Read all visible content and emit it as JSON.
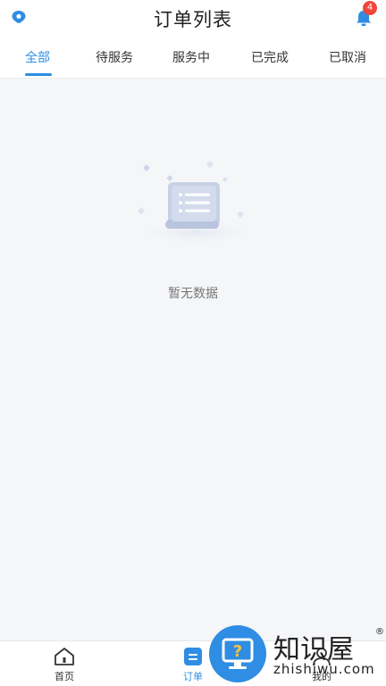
{
  "header": {
    "title": "订单列表",
    "notification_count": "4",
    "left_icon": "location-pin-icon",
    "bell_icon": "bell-icon"
  },
  "tabs": [
    {
      "label": "全部",
      "active": true
    },
    {
      "label": "待服务",
      "active": false
    },
    {
      "label": "服务中",
      "active": false
    },
    {
      "label": "已完成",
      "active": false
    },
    {
      "label": "已取消",
      "active": false
    }
  ],
  "empty_state": {
    "icon": "empty-list-icon",
    "text": "暂无数据"
  },
  "bottom_nav": [
    {
      "label": "首页",
      "icon": "home-icon",
      "active": false
    },
    {
      "label": "订单",
      "icon": "order-list-icon",
      "active": true
    },
    {
      "label": "我的",
      "icon": "user-icon",
      "active": false
    }
  ],
  "watermark": {
    "title": "知识屋",
    "subtitle": "zhishiwu.com",
    "registered": "®"
  },
  "colors": {
    "accent": "#2f8de4",
    "badge": "#f0463c",
    "background": "#f5f6f8"
  }
}
